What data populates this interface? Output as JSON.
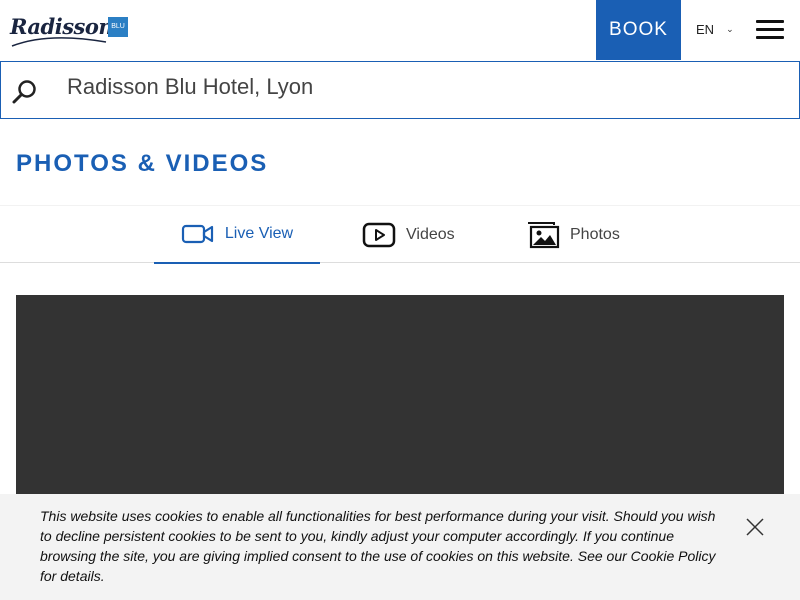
{
  "header": {
    "logo_text": "Radisson",
    "logo_badge": "BLU",
    "book_label": "BOOK",
    "language": "EN"
  },
  "search": {
    "value": "Radisson Blu Hotel, Lyon"
  },
  "page": {
    "title": "PHOTOS & VIDEOS"
  },
  "tabs": [
    {
      "label": "Live View",
      "icon": "video-camera-icon",
      "active": true
    },
    {
      "label": "Videos",
      "icon": "play-icon",
      "active": false
    },
    {
      "label": "Photos",
      "icon": "image-icon",
      "active": false
    }
  ],
  "cookie_banner": {
    "text": "This website uses cookies to enable all functionalities for best performance during your visit. Should you wish to decline persistent cookies to be sent to you, kindly adjust your computer accordingly. If you continue browsing the site, you are giving implied consent to the use of cookies on this website. See our ",
    "link_label": "Cookie Policy",
    "suffix": " for details."
  },
  "colors": {
    "brand_blue": "#1a5fb4",
    "video_bg": "#333333",
    "cookie_bg": "#f3f3f3"
  }
}
